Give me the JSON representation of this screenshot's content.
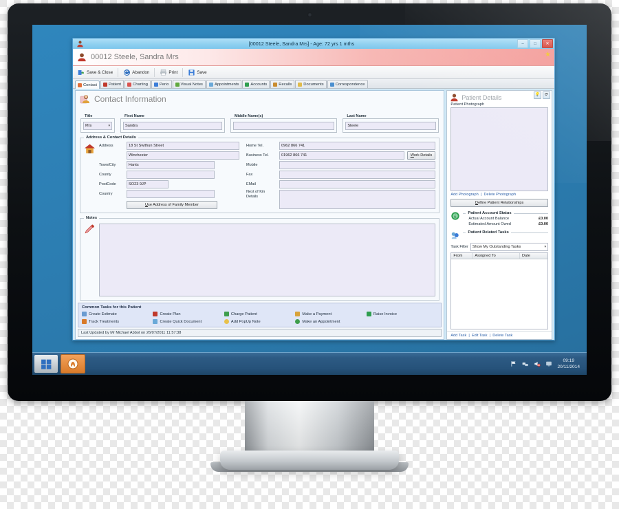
{
  "window": {
    "title": "[00012 Steele, Sandra Mrs] - Age: 72 yrs 1 mths",
    "icon": "patient-icon",
    "minimize": "–",
    "maximize": "□",
    "close": "✕"
  },
  "patient_header": {
    "name": "00012 Steele, Sandra Mrs",
    "favourite_icon": "star-icon"
  },
  "toolbar": {
    "buttons": [
      {
        "label": "Save & Close",
        "icon": "save-close-icon"
      },
      {
        "label": "Abandon",
        "icon": "undo-icon"
      },
      {
        "label": "Print",
        "icon": "printer-icon"
      },
      {
        "label": "Save",
        "icon": "floppy-icon"
      }
    ]
  },
  "tabs": [
    {
      "label": "Contact",
      "icon": "home-icon",
      "color": "#e2703a",
      "active": true
    },
    {
      "label": "Patient",
      "icon": "person-icon",
      "color": "#c0392b",
      "active": false
    },
    {
      "label": "Charting",
      "icon": "tooth-icon",
      "color": "#d9534f",
      "active": false
    },
    {
      "label": "Perio",
      "icon": "chart-icon",
      "color": "#3b7dd8",
      "active": false
    },
    {
      "label": "Visual Notes",
      "icon": "brush-icon",
      "color": "#5fa83d",
      "active": false
    },
    {
      "label": "Appointments",
      "icon": "clock-icon",
      "color": "#6aa9d8",
      "active": false
    },
    {
      "label": "Accounts",
      "icon": "money-icon",
      "color": "#2e9e4f",
      "active": false
    },
    {
      "label": "Recalls",
      "icon": "recall-icon",
      "color": "#c98c2e",
      "active": false
    },
    {
      "label": "Documents",
      "icon": "folder-icon",
      "color": "#e0bb4a",
      "active": false
    },
    {
      "label": "Correspondence",
      "icon": "letter-icon",
      "color": "#4a8fd0",
      "active": false
    }
  ],
  "contact_section": {
    "heading": "Contact Information",
    "heading_icon": "contacts-icon",
    "name_fields": [
      {
        "label": "Title",
        "value": "Mrs",
        "type": "select"
      },
      {
        "label": "First Name",
        "value": "Sandra",
        "type": "text"
      },
      {
        "label": "Middle Name(s)",
        "value": "",
        "type": "text"
      },
      {
        "label": "Last Name",
        "value": "Steele",
        "type": "text"
      }
    ],
    "address_group": {
      "legend": "Address & Contact Details",
      "icon": "house-icon",
      "left_fields": [
        {
          "label": "Address",
          "value": "18 St Swithun Street"
        },
        {
          "label": "",
          "value": "Winchester"
        },
        {
          "label": "Town/City",
          "value": "Hants"
        },
        {
          "label": "County",
          "value": ""
        },
        {
          "label": "PostCode",
          "value": "SO23 9JP"
        },
        {
          "label": "Country",
          "value": ""
        }
      ],
      "family_button": "Use Address of Family Member",
      "right_fields": [
        {
          "label": "Home Tel.",
          "value": "0962 866 741"
        },
        {
          "label": "Business Tel.",
          "value": "01962 866 741"
        },
        {
          "label": "Mobile",
          "value": ""
        },
        {
          "label": "Fax",
          "value": ""
        },
        {
          "label": "EMail",
          "value": ""
        },
        {
          "label": "Next of Kin Details",
          "value": ""
        }
      ],
      "work_details_button": "Work Details"
    },
    "notes": {
      "legend": "Notes",
      "icon": "notes-brush-icon",
      "value": ""
    }
  },
  "common_tasks": {
    "title": "Common Tasks for this Patient",
    "items": [
      {
        "label": "Create Estimate",
        "icon": "estimate-icon",
        "color": "#6a9bd1"
      },
      {
        "label": "Create Plan",
        "icon": "plan-icon",
        "color": "#c0392b"
      },
      {
        "label": "Charge Patient",
        "icon": "charge-icon",
        "color": "#3f9e4d"
      },
      {
        "label": "Make a Payment",
        "icon": "payment-icon",
        "color": "#d8a33a"
      },
      {
        "label": "Raise Invoice",
        "icon": "invoice-icon",
        "color": "#2e9e4f"
      },
      {
        "label": "Track Treatments",
        "icon": "track-icon",
        "color": "#d87a2a"
      },
      {
        "label": "Create Quick Document",
        "icon": "document-icon",
        "color": "#6aa9d8"
      },
      {
        "label": "Add PopUp Note",
        "icon": "popup-note-icon",
        "color": "#e8c14a"
      },
      {
        "label": "Make an Appointment",
        "icon": "appointment-icon",
        "color": "#3f9e4d"
      }
    ]
  },
  "status_bar": {
    "text": "Last Updated by Mr Michael Abbot on 26/07/2011 11:57:38"
  },
  "patient_details": {
    "heading": "Patient Details",
    "heading_icon": "patient-icon",
    "tools": [
      {
        "icon": "bulb-icon",
        "glyph": "💡"
      },
      {
        "icon": "refresh-icon",
        "glyph": "⟳"
      },
      {
        "icon": "export-icon",
        "glyph": "⇲"
      }
    ],
    "photograph_label": "Patient Photograph",
    "photo_links": [
      "Add Photograph",
      "Delete Photograph"
    ],
    "relationships_button": "Define Patient Relationships",
    "account_status": {
      "title": "Patient Account Status",
      "icon": "money-badge-icon",
      "rows": [
        {
          "label": "Actual Account Balance",
          "value": "£0.00"
        },
        {
          "label": "Estimated Amount Owed",
          "value": "£0.00"
        }
      ]
    },
    "related_tasks": {
      "title": "Patient Related Tasks",
      "icon": "tasks-icon",
      "filter_label": "Task Filter",
      "filter_value": "Show My Outstanding Tasks",
      "columns": [
        "From",
        "Assigned To",
        "Date"
      ],
      "rows": [],
      "links": [
        "Add Task",
        "Edit Task",
        "Delete Task"
      ]
    }
  },
  "taskbar": {
    "start_icon": "windows-start-icon",
    "app_icon": "app-icon",
    "tray_icons": [
      {
        "icon": "flag-icon"
      },
      {
        "icon": "network-icon"
      },
      {
        "icon": "volume-muted-icon"
      },
      {
        "icon": "monitor-icon"
      }
    ],
    "clock_time": "09:19",
    "clock_date": "20/11/2014"
  }
}
